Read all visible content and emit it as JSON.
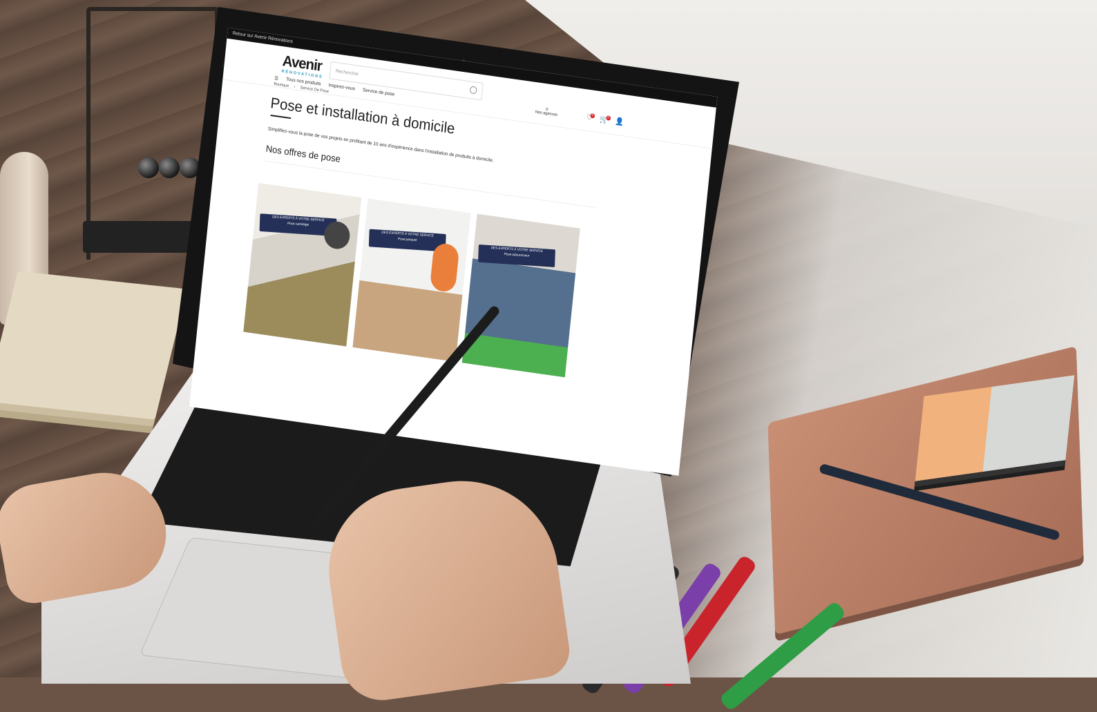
{
  "page": {
    "topbar_text": "Retour sur Avenir Rénovations",
    "logo": {
      "name": "Avenir",
      "tagline": "RÉNOVATIONS"
    },
    "search": {
      "placeholder": "Rechercher"
    },
    "nav": {
      "all_products": "Tous nos produits",
      "inspiration": "Inspirez-vous",
      "service": "Service de pose"
    },
    "agencies_label": "Nos agences",
    "icons": [
      "heart-icon",
      "cart-icon",
      "user-icon",
      "location-icon",
      "search-icon",
      "menu-icon"
    ],
    "badges": {
      "wishlist": "0",
      "cart": "0"
    },
    "breadcrumb": [
      "Boutique",
      "Service De Pose"
    ],
    "title": "Pose et installation à domicile",
    "intro": "Simplifiez-vous la pose de vos projets en profitant de 10 ans d'expérience dans l'installation de produits à domicile.",
    "offers_title": "Nos offres de pose",
    "cards": [
      {
        "banner": "DES EXPERTS À VOTRE SERVICE",
        "sub": "Pose carrelage"
      },
      {
        "banner": "DES EXPERTS À VOTRE SERVICE",
        "sub": "Pose parquet"
      },
      {
        "banner": "DES EXPERTS À VOTRE SERVICE",
        "sub": "Pose adoucisseur"
      }
    ]
  },
  "colors": {
    "brand_blue": "#2a9bc6",
    "banner_navy": "#243057",
    "badge_red": "#d9262b"
  }
}
